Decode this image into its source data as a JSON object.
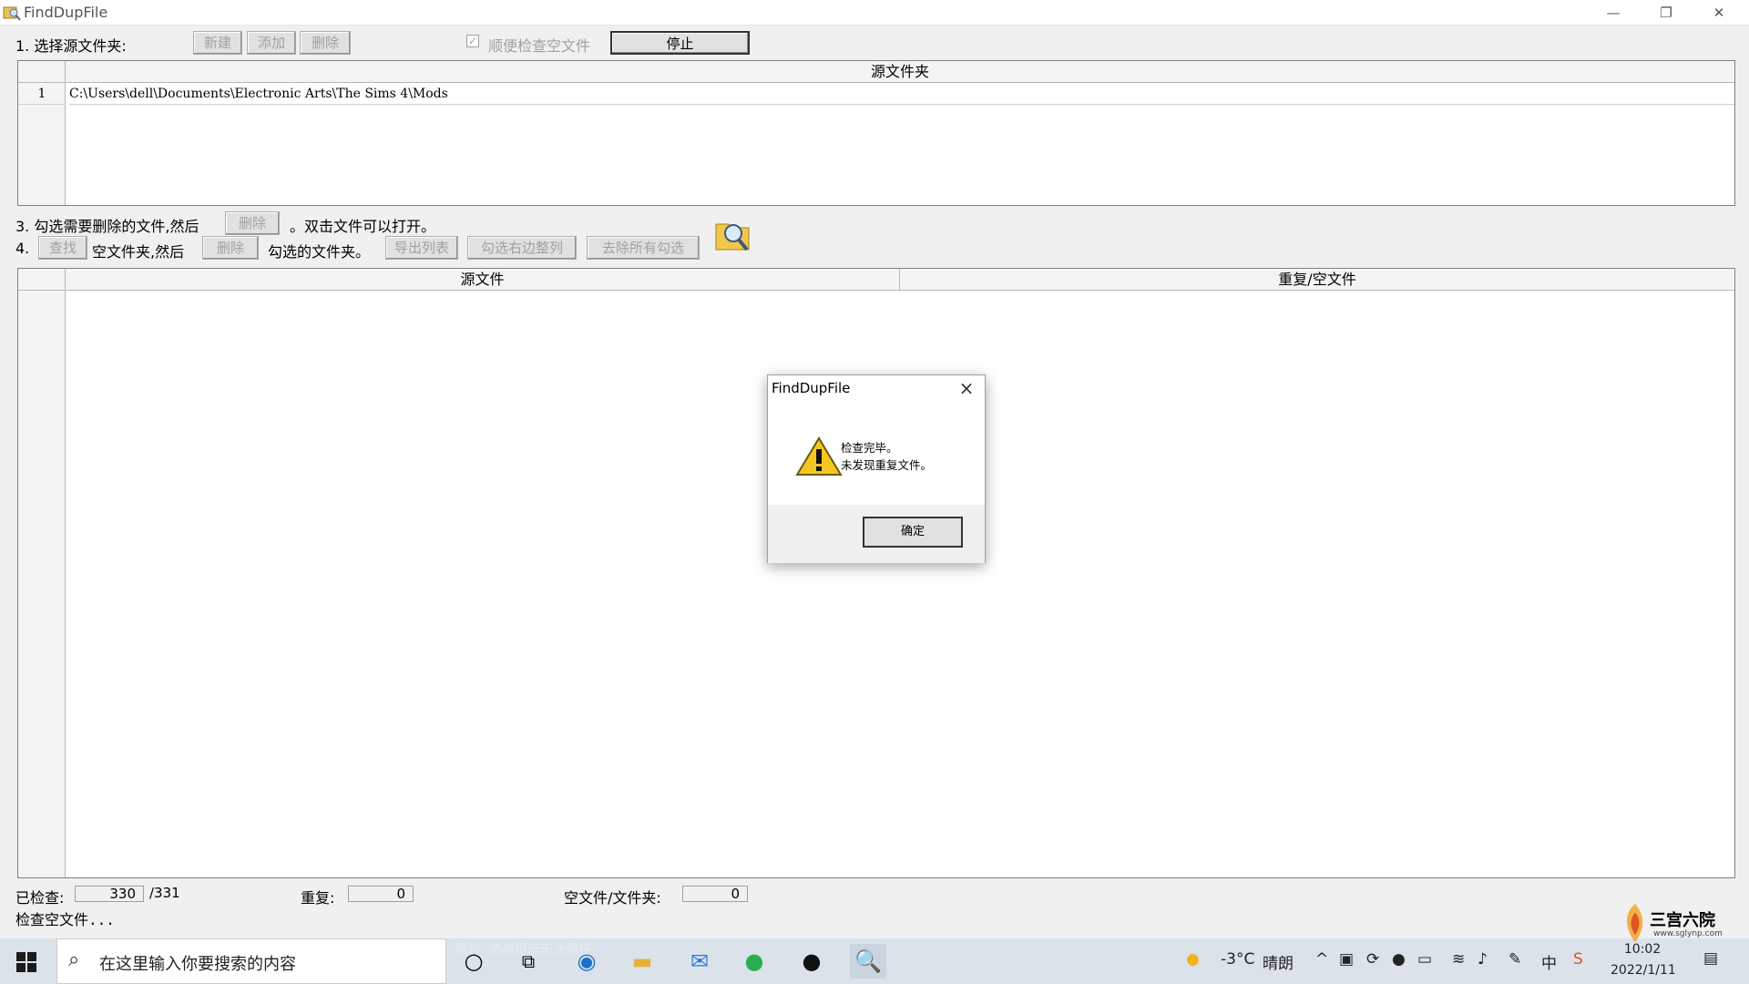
{
  "window": {
    "title": "FindDupFile",
    "controls": {
      "minimize": "—",
      "maximize": "❐",
      "close": "✕"
    }
  },
  "step1": {
    "label": "1. 选择源文件夹:",
    "new_label": "新建",
    "add_label": "添加",
    "delete_label": "删除",
    "check_empty_label": "顺便检查空文件",
    "check_empty_checked": true,
    "stop_label": "停止"
  },
  "source_grid": {
    "header": "源文件夹",
    "rows": [
      {
        "index": "1",
        "path": "C:\\Users\\dell\\Documents\\Electronic Arts\\The Sims 4\\Mods"
      }
    ]
  },
  "step3": {
    "prefix": "3. 勾选需要删除的文件,然后",
    "delete_label": "删除",
    "suffix": "。双击文件可以打开。"
  },
  "step4": {
    "prefix": "4.",
    "find_label": "查找",
    "middle": "空文件夹,然后",
    "delete_label": "删除",
    "suffix": "勾选的文件夹。",
    "export_label": "导出列表",
    "align_label": "勾选右边整列",
    "clear_label": "去除所有勾选"
  },
  "results_grid": {
    "col_source": "源文件",
    "col_dup": "重复/空文件"
  },
  "stats": {
    "checked_label": "已检查:",
    "checked_value": "330",
    "checked_total": "/331",
    "dup_label": "重复:",
    "dup_value": "0",
    "empty_label": "空文件/文件夹:",
    "empty_value": "0"
  },
  "status_text": "检查空文件...",
  "dialog": {
    "title": "FindDupFile",
    "line1": "检查完毕。",
    "line2": "未发现重复文件。",
    "ok_label": "确定"
  },
  "taskbar": {
    "search_placeholder": "在这里输入你要搜索的内容",
    "weather_temp": "-3°C",
    "weather_text": "晴朗",
    "ime": "中",
    "time": "10:02",
    "date": "2022/1/11",
    "watermark_text": "三宫六院",
    "watermark_url": "www.sglynp.com",
    "faint_overlay": "警告: 选者提示无法信任"
  }
}
